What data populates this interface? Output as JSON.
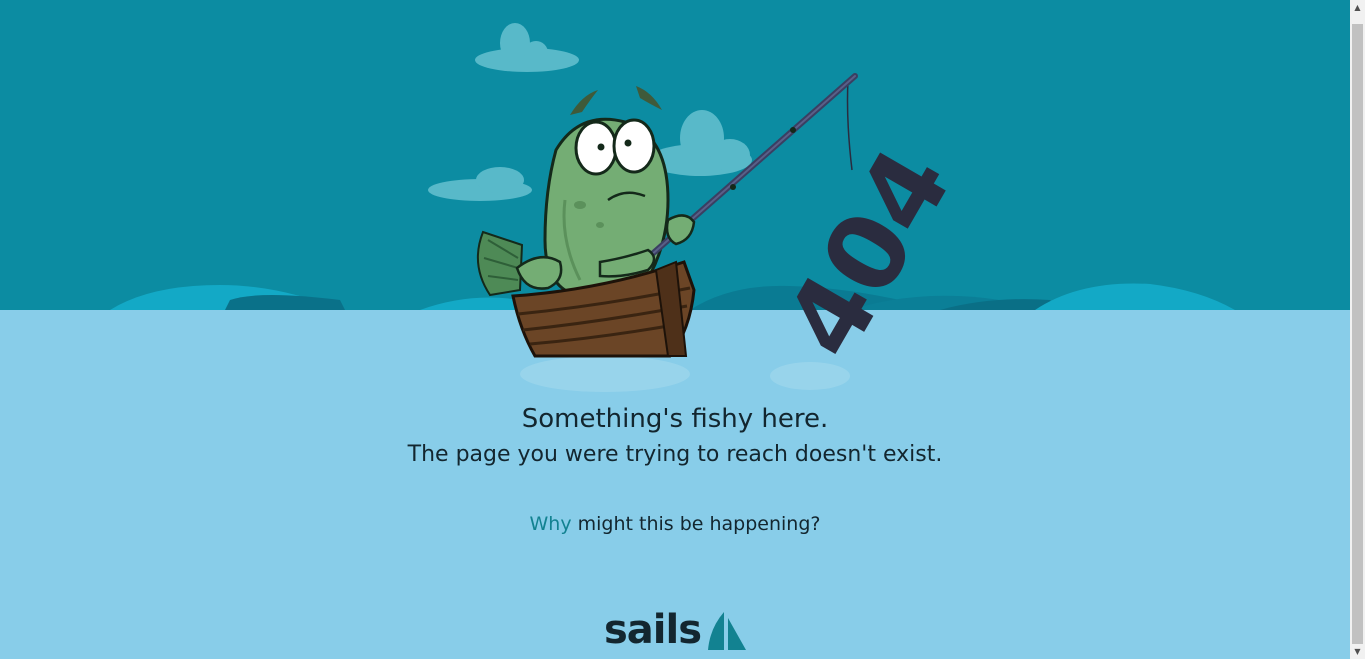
{
  "scene": {
    "sign_text": "404",
    "colors": {
      "sky": "#0c8ca2",
      "water": "#88cde9",
      "wave": "#13a9c6",
      "fish": "#74ad74",
      "boat": "#6b4526",
      "sign": "#2a2c3f"
    }
  },
  "message": {
    "headline": "Something's fishy here.",
    "subline": "The page you were trying to reach doesn't exist."
  },
  "help": {
    "link_label": "Why",
    "rest": " might this be happening?"
  },
  "footer": {
    "logo_text": "sails",
    "logo_mark_icon": "sailboat-icon"
  },
  "scrollbar": {
    "up_icon": "▲",
    "down_icon": "▼"
  }
}
